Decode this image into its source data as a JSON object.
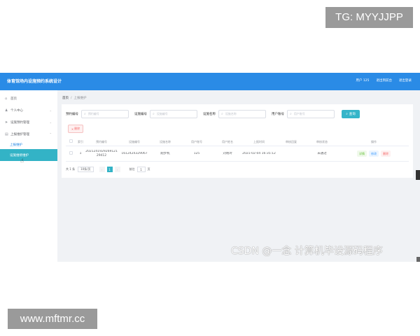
{
  "watermarks": {
    "tg": "TG: MYYJJPP",
    "url": "www.mftmr.cc",
    "csdn": "CSDN @一念 计算机毕设源码程序"
  },
  "header": {
    "title": "体育馆场内设施预约系统设计",
    "links": [
      "用户 125",
      "退出到前台",
      "退出登录"
    ]
  },
  "sidebar": {
    "items": [
      {
        "icon": "home-icon",
        "glyph": "⌂",
        "label": "首页"
      },
      {
        "icon": "user-icon",
        "glyph": "♟",
        "label": "个人中心",
        "arrow": "⌄"
      },
      {
        "icon": "send-icon",
        "glyph": "➤",
        "label": "设施预约管理",
        "arrow": "⌄"
      },
      {
        "icon": "folder-icon",
        "glyph": "▤",
        "label": "上报维护管理",
        "arrow": "⌃"
      }
    ],
    "subitems": [
      "上报维护",
      "设施维修维护"
    ]
  },
  "breadcrumb": {
    "home": "首页",
    "sep": "/",
    "current": "上报维护"
  },
  "search": {
    "fields": [
      {
        "label": "预约编号",
        "placeholder": "预约编号"
      },
      {
        "label": "设施编号",
        "placeholder": "设施编号"
      },
      {
        "label": "设施名称",
        "placeholder": "设施名称"
      },
      {
        "label": "用户账号",
        "placeholder": "用户账号"
      }
    ],
    "button": "查询"
  },
  "toolbar": {
    "delete_label": "删除"
  },
  "table": {
    "columns": [
      "索引",
      "预约编号",
      "设施编号",
      "设施名称",
      "用户账号",
      "用户姓名",
      "上报时间",
      "审核回复",
      "审核状态",
      "操作"
    ],
    "rows": [
      {
        "index": "1",
        "booking_no": "2021241929269121 29412",
        "facility_no": "1612424329067",
        "facility_name": "跑步机",
        "account": "125",
        "user_name": "刘晓玲",
        "report_time": "2021-02-04 16:35:12",
        "reply": "",
        "status": "未通过",
        "actions": {
          "detail": "详情",
          "edit": "修改",
          "delete": "删除"
        }
      }
    ]
  },
  "pagination": {
    "total": "共 1 条",
    "page_size": "10条/页",
    "prev": "‹",
    "current": "1",
    "next": "›",
    "goto_label": "前往",
    "goto_value": "1",
    "goto_suffix": "页"
  },
  "colors": {
    "header": "#2a8be6",
    "accent": "#33b3c6",
    "danger": "#f56c6c"
  }
}
